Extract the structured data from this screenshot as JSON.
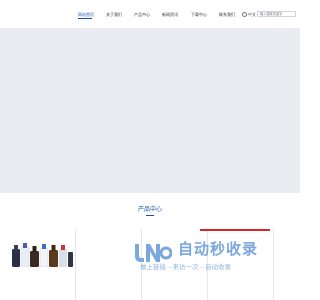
{
  "nav": {
    "items": [
      {
        "label": "网站首页",
        "active": true
      },
      {
        "label": "关于我们",
        "active": false
      },
      {
        "label": "产品中心",
        "active": false
      },
      {
        "label": "新闻资讯",
        "active": false
      },
      {
        "label": "下载中心",
        "active": false
      },
      {
        "label": "联系我们",
        "active": false
      }
    ],
    "lang_label": "中文",
    "search_placeholder": "输入搜索关键字"
  },
  "section": {
    "title": "产品中心"
  },
  "watermark": {
    "brand": "自动秒收录",
    "tagline": "做上链接→来访一次→自动收录"
  },
  "colors": {
    "accent": "#1a4da8",
    "banner_bg": "#eaecf1",
    "watermark": "#7aa7dc",
    "red_bar": "#d8262a"
  },
  "icons": [
    "globe-icon",
    "watermark-logo-icon"
  ]
}
